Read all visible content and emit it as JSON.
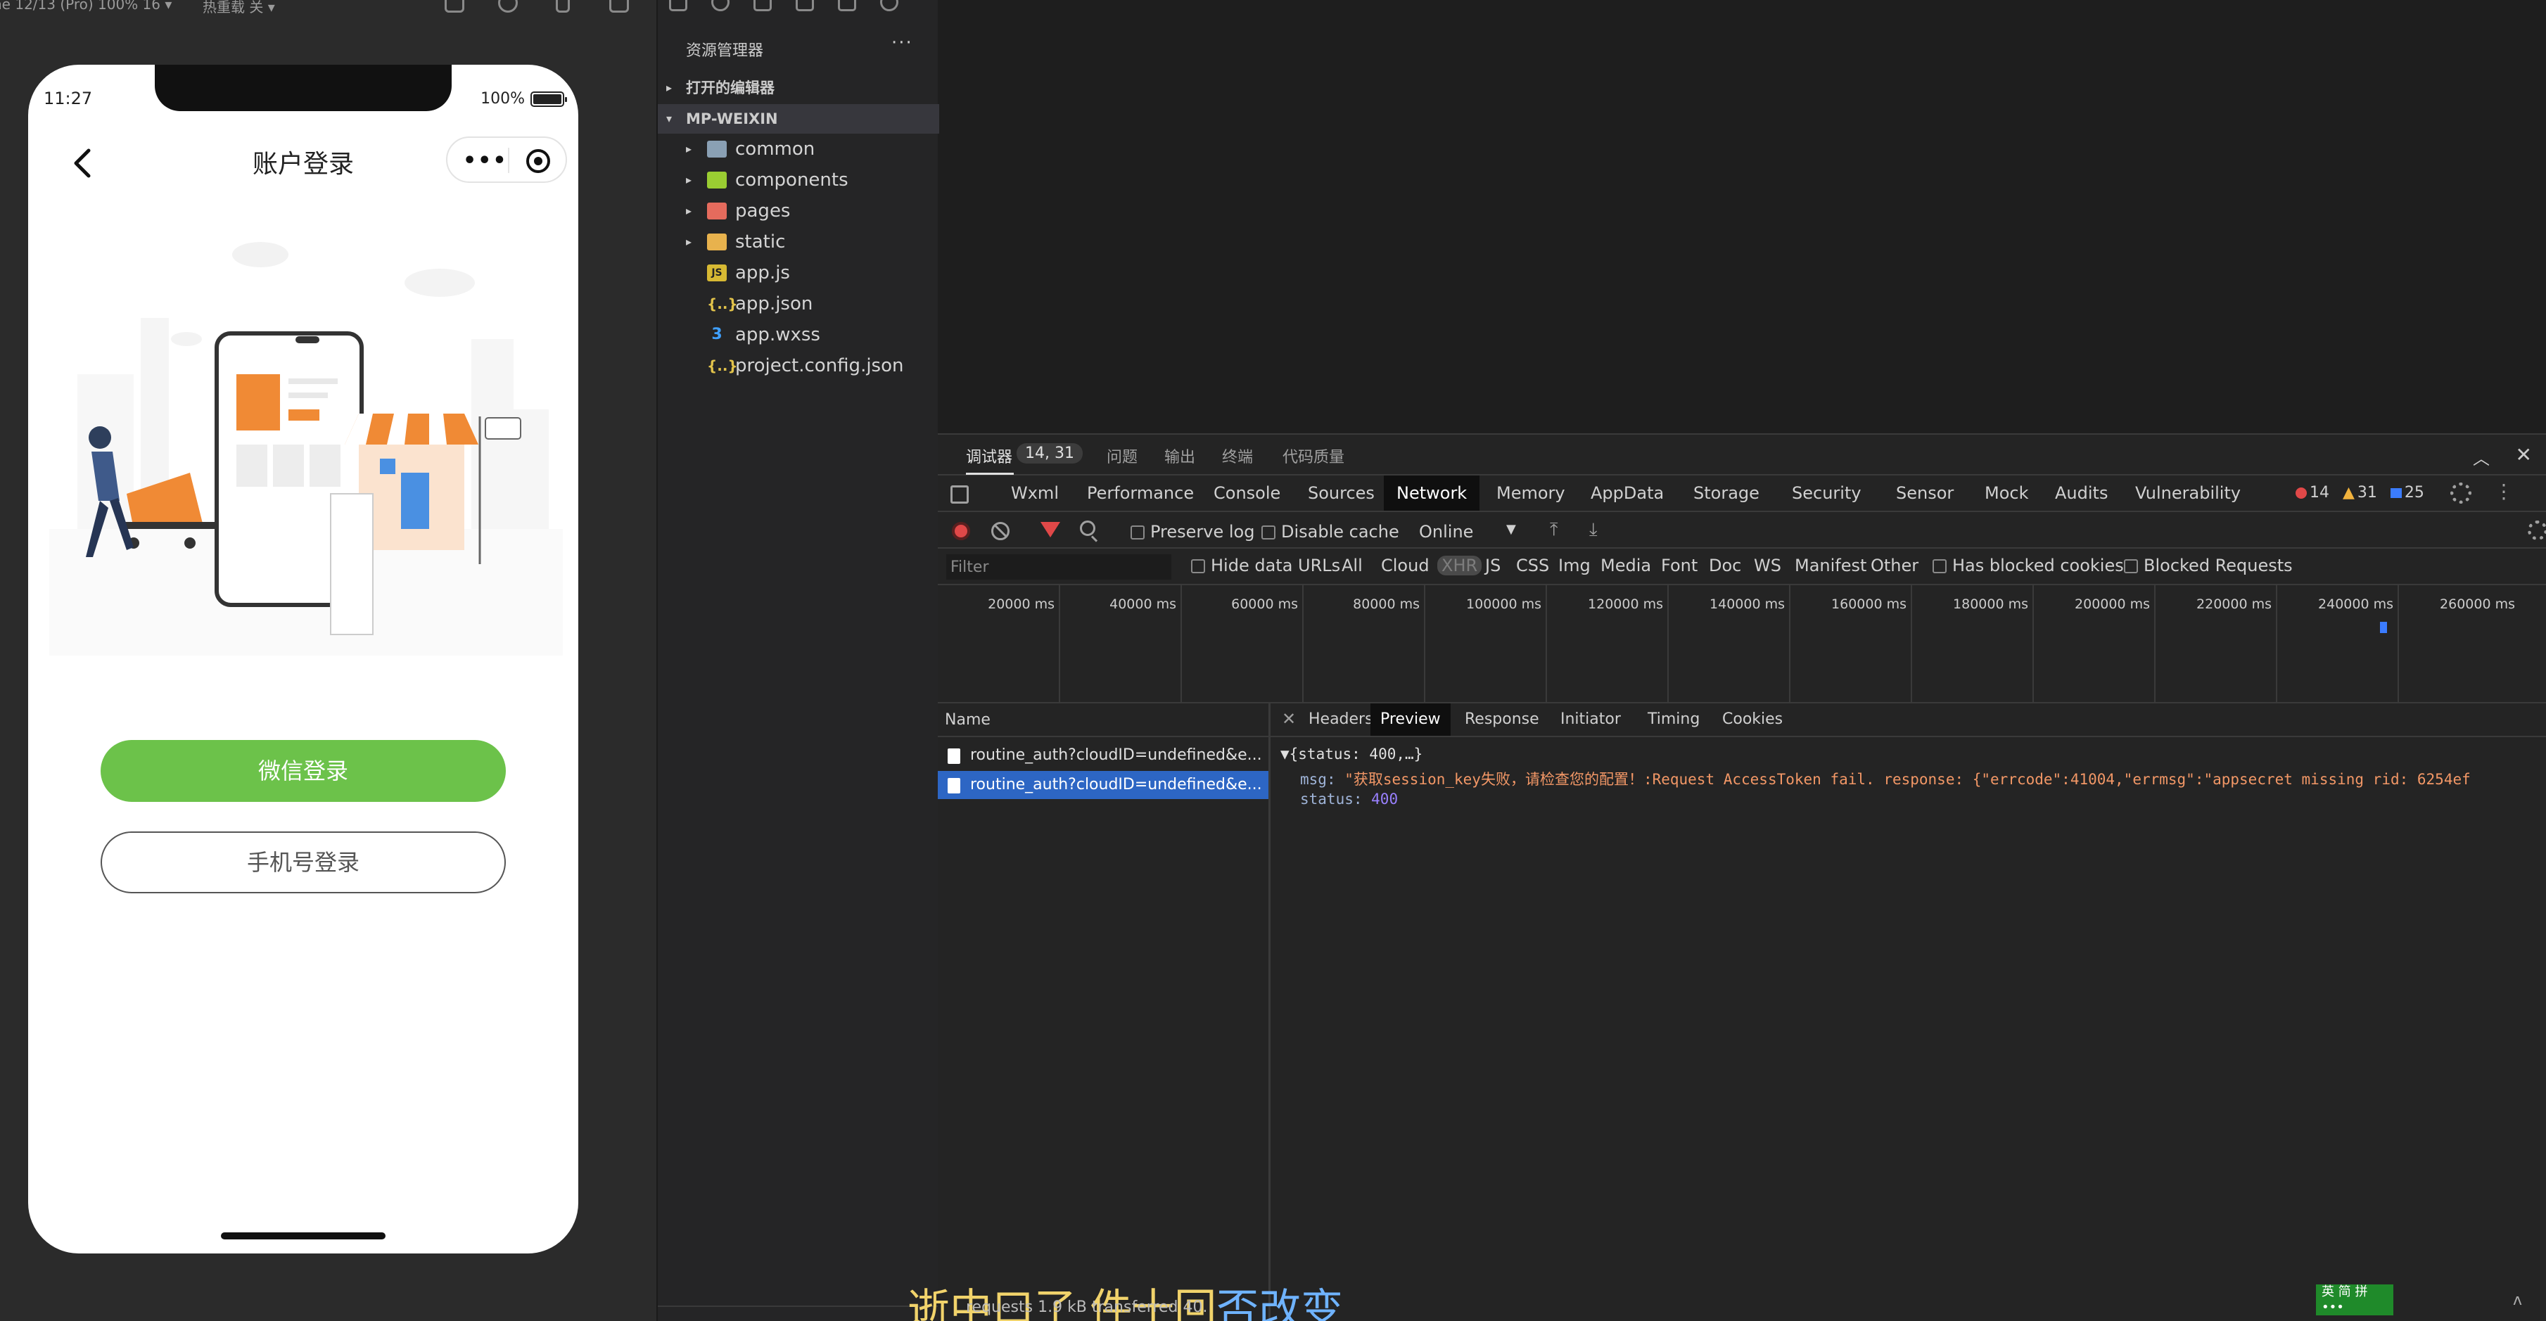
{
  "simulator": {
    "top_left": "ne 12/13 (Pro) 100% 16 ▾",
    "top_mid": "热重载 关 ▾",
    "time": "11:27",
    "battery": "100%",
    "nav_title": "账户登录",
    "capsule_dots": "•••",
    "wechat_login": "微信登录",
    "phone_login": "手机号登录"
  },
  "explorer": {
    "title": "资源管理器",
    "more": "···",
    "open_editors": "打开的编辑器",
    "root": "MP-WEIXIN",
    "items": [
      {
        "name": "common",
        "type": "folder",
        "color": "#8aa0b4"
      },
      {
        "name": "components",
        "type": "folder",
        "color": "#9acd32"
      },
      {
        "name": "pages",
        "type": "folder",
        "color": "#e56b5d"
      },
      {
        "name": "static",
        "type": "folder",
        "color": "#e8b24d"
      },
      {
        "name": "app.js",
        "type": "js"
      },
      {
        "name": "app.json",
        "type": "json"
      },
      {
        "name": "app.wxss",
        "type": "wxss"
      },
      {
        "name": "project.config.json",
        "type": "json"
      }
    ]
  },
  "devtools": {
    "top_tabs": {
      "debugger": "调试器",
      "debugger_count": "14, 31",
      "issues": "问题",
      "output": "输出",
      "terminal": "终端",
      "code_quality": "代码质量"
    },
    "panel_tabs": [
      "Wxml",
      "Performance",
      "Console",
      "Sources",
      "Network",
      "Memory",
      "AppData",
      "Storage",
      "Security",
      "Sensor",
      "Mock",
      "Audits",
      "Vulnerability"
    ],
    "active_panel": "Network",
    "issue_counts": {
      "errors": "14",
      "warnings": "31",
      "info": "25"
    },
    "toolbar": {
      "preserve_log": "Preserve log",
      "disable_cache": "Disable cache",
      "throttle": "Online"
    },
    "filter": {
      "placeholder": "Filter",
      "hide_data_urls": "Hide data URLs",
      "types": [
        "All",
        "Cloud",
        "XHR",
        "JS",
        "CSS",
        "Img",
        "Media",
        "Font",
        "Doc",
        "WS",
        "Manifest",
        "Other"
      ],
      "selected_type": "XHR",
      "has_blocked_cookies": "Has blocked cookies",
      "blocked_requests": "Blocked Requests"
    },
    "timeline_labels": [
      "20000 ms",
      "40000 ms",
      "60000 ms",
      "80000 ms",
      "100000 ms",
      "120000 ms",
      "140000 ms",
      "160000 ms",
      "180000 ms",
      "200000 ms",
      "220000 ms",
      "240000 ms",
      "260000 ms"
    ],
    "requests": {
      "header": "Name",
      "rows": [
        {
          "name": "routine_auth?cloudID=undefined&e..."
        },
        {
          "name": "routine_auth?cloudID=undefined&e..."
        }
      ]
    },
    "detail_tabs": [
      "Headers",
      "Preview",
      "Response",
      "Initiator",
      "Timing",
      "Cookies"
    ],
    "active_detail": "Preview",
    "preview": {
      "root": "▼{status: 400,…}",
      "msg_key": "msg",
      "msg_value": "\"获取session_key失败，请检查您的配置！:Request AccessToken fail. response: {\"errcode\":41004,\"errmsg\":\"appsecret missing rid: 6254ef",
      "status_key": "status",
      "status_value": "400"
    },
    "footer": "requests  1.9 kB transferred  40."
  },
  "overlay": {
    "subtitle_a": "逝中口了 件十回",
    "subtitle_b": "否改变",
    "ime": "英 简 拼 •••"
  }
}
